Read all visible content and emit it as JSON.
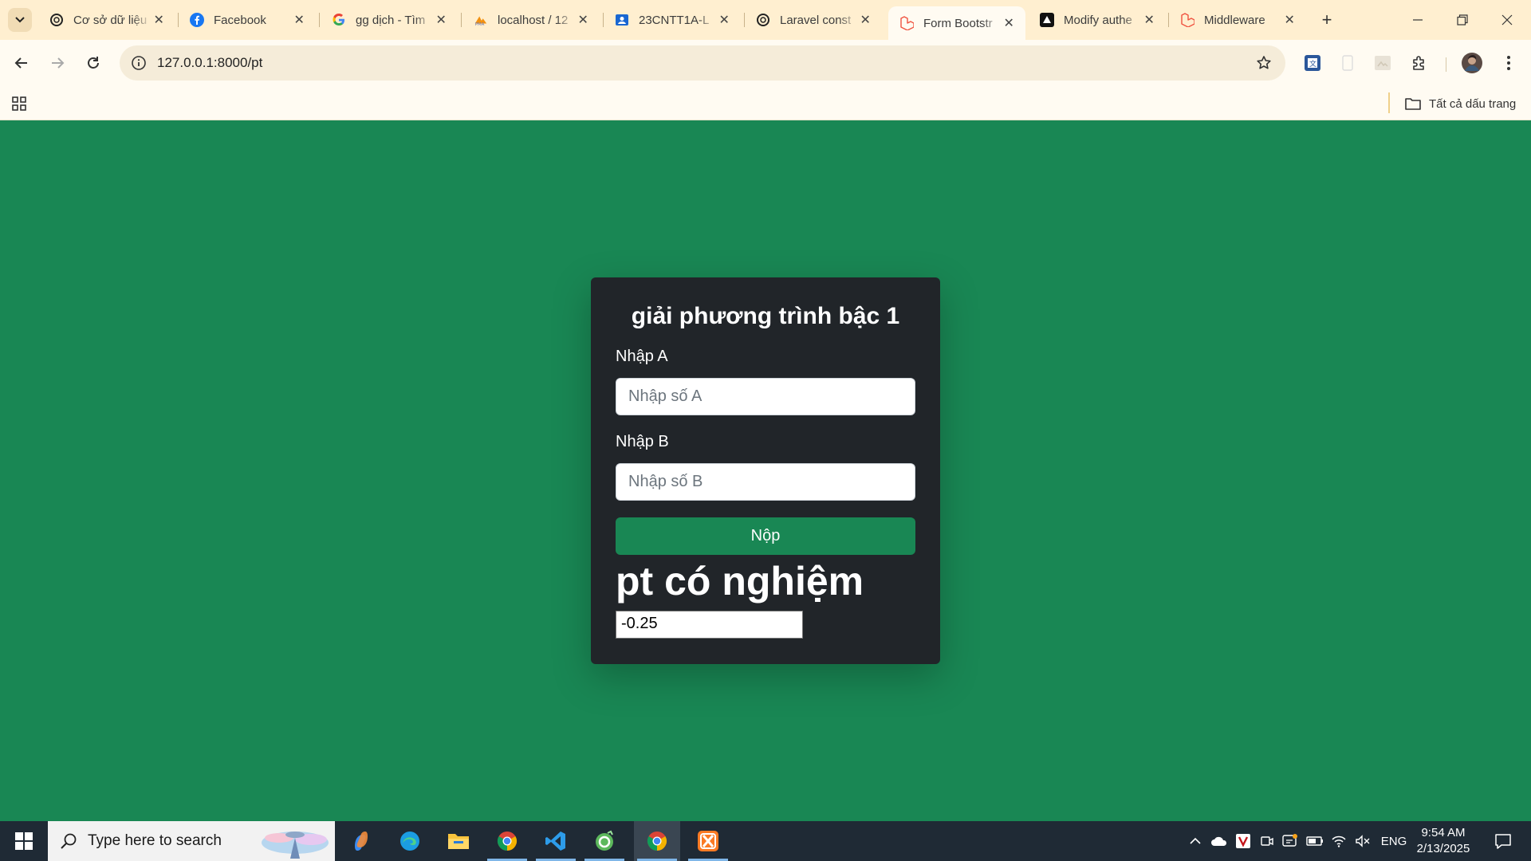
{
  "browser": {
    "tabs": [
      {
        "title": "Cơ sở dữ liệu",
        "icon": "openai-icon"
      },
      {
        "title": "Facebook",
        "icon": "facebook-icon"
      },
      {
        "title": "gg dịch - Tìm",
        "icon": "google-icon"
      },
      {
        "title": "localhost / 12",
        "icon": "phpmyadmin-icon"
      },
      {
        "title": "23CNTT1A-L",
        "icon": "classroom-icon"
      },
      {
        "title": "Laravel const",
        "icon": "openai-icon"
      },
      {
        "title": "Form Bootstr",
        "icon": "laravel-icon",
        "active": true
      },
      {
        "title": "Modify authe",
        "icon": "vercel-icon"
      },
      {
        "title": "Middleware",
        "icon": "laravel-icon"
      }
    ],
    "url": "127.0.0.1:8000/pt",
    "bookmarks": {
      "all_label": "Tất cả dấu trang"
    },
    "colors": {
      "frame": "#ffefd0",
      "toolbar": "#fffbf2"
    }
  },
  "page": {
    "title": "giải phương trình bậc 1",
    "field_a": {
      "label": "Nhập A",
      "placeholder": "Nhập số A",
      "value": ""
    },
    "field_b": {
      "label": "Nhập B",
      "placeholder": "Nhập số B",
      "value": ""
    },
    "submit_label": "Nộp",
    "result_heading": "pt có nghiệm",
    "result_value": "-0.25",
    "colors": {
      "background": "#198754",
      "card": "#212529",
      "button": "#198754"
    }
  },
  "taskbar": {
    "search_placeholder": "Type here to search",
    "apps": [
      "copilot-icon",
      "edge-icon",
      "file-explorer-icon",
      "chrome-icon",
      "vscode-icon",
      "app-icon",
      "chrome-icon",
      "xampp-icon"
    ],
    "language": "ENG",
    "time": "9:54 AM",
    "date": "2/13/2025"
  }
}
